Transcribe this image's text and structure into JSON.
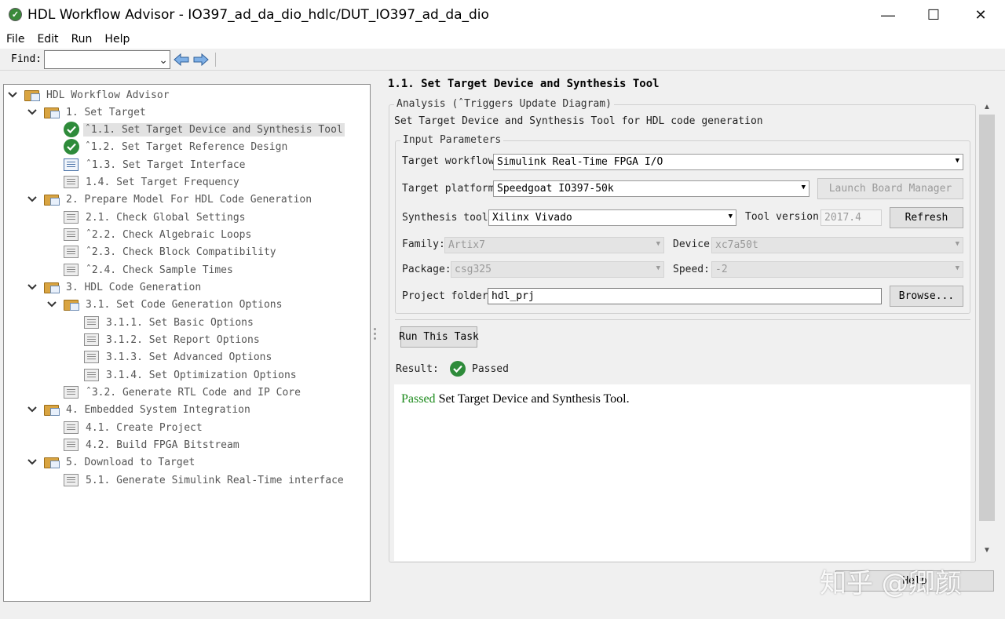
{
  "window": {
    "title": "HDL Workflow Advisor - IO397_ad_da_dio_hdlc/DUT_IO397_ad_da_dio",
    "minimize": "—",
    "maximize": "☐",
    "close": "✕"
  },
  "menu": [
    "File",
    "Edit",
    "Run",
    "Help"
  ],
  "find": {
    "label": "Find:",
    "value": "",
    "dropdown": "⌄"
  },
  "tree": [
    {
      "label": "HDL Workflow Advisor"
    },
    {
      "label": "1. Set Target"
    },
    {
      "label": "ˆ1.1. Set Target Device and Synthesis Tool"
    },
    {
      "label": "ˆ1.2. Set Target Reference Design"
    },
    {
      "label": "ˆ1.3. Set Target Interface"
    },
    {
      "label": "1.4. Set Target Frequency"
    },
    {
      "label": "2. Prepare Model For HDL Code Generation"
    },
    {
      "label": "2.1. Check Global Settings"
    },
    {
      "label": "ˆ2.2. Check Algebraic Loops"
    },
    {
      "label": "ˆ2.3. Check Block Compatibility"
    },
    {
      "label": "ˆ2.4. Check Sample Times"
    },
    {
      "label": "3. HDL Code Generation"
    },
    {
      "label": "3.1. Set Code Generation Options"
    },
    {
      "label": "3.1.1. Set Basic Options"
    },
    {
      "label": "3.1.2. Set Report Options"
    },
    {
      "label": "3.1.3. Set Advanced Options"
    },
    {
      "label": "3.1.4. Set Optimization Options"
    },
    {
      "label": "ˆ3.2. Generate RTL Code and IP Core"
    },
    {
      "label": "4. Embedded System Integration"
    },
    {
      "label": "4.1. Create Project"
    },
    {
      "label": "4.2. Build FPGA Bitstream"
    },
    {
      "label": "5. Download to Target"
    },
    {
      "label": "5.1. Generate Simulink Real-Time interface"
    }
  ],
  "task": {
    "title": "1.1. Set Target Device and Synthesis Tool",
    "analysis_legend": "Analysis (ˆTriggers Update Diagram)",
    "description": "Set Target Device and Synthesis Tool for HDL code generation",
    "params_legend": "Input Parameters",
    "target_workflow_label": "Target workflow:",
    "target_workflow_value": "Simulink Real-Time FPGA I/O",
    "target_platform_label": "Target platform:",
    "target_platform_value": "Speedgoat IO397-50k",
    "launch_board_manager": "Launch Board Manager",
    "synthesis_tool_label": "Synthesis tool:",
    "synthesis_tool_value": "Xilinx Vivado",
    "tool_version_label": "Tool version:",
    "tool_version_value": "2017.4",
    "refresh": "Refresh",
    "family_label": "Family:",
    "family_value": "Artix7",
    "device_label": "Device:",
    "device_value": "xc7a50t",
    "package_label": "Package:",
    "package_value": "csg325",
    "speed_label": "Speed:",
    "speed_value": "-2",
    "project_folder_label": "Project folder:",
    "project_folder_value": "hdl_prj",
    "browse": "Browse...",
    "run_task": "Run This Task",
    "result_label": "Result:",
    "result_value": "Passed",
    "report_passed": "Passed",
    "report_rest": " Set Target Device and Synthesis Tool.",
    "help": "Help"
  },
  "watermark": "知乎 @卿颜",
  "colors": {
    "passed_green": "#1b8a1b",
    "check_green": "#2e8b3a",
    "folder": "#d9a441"
  }
}
